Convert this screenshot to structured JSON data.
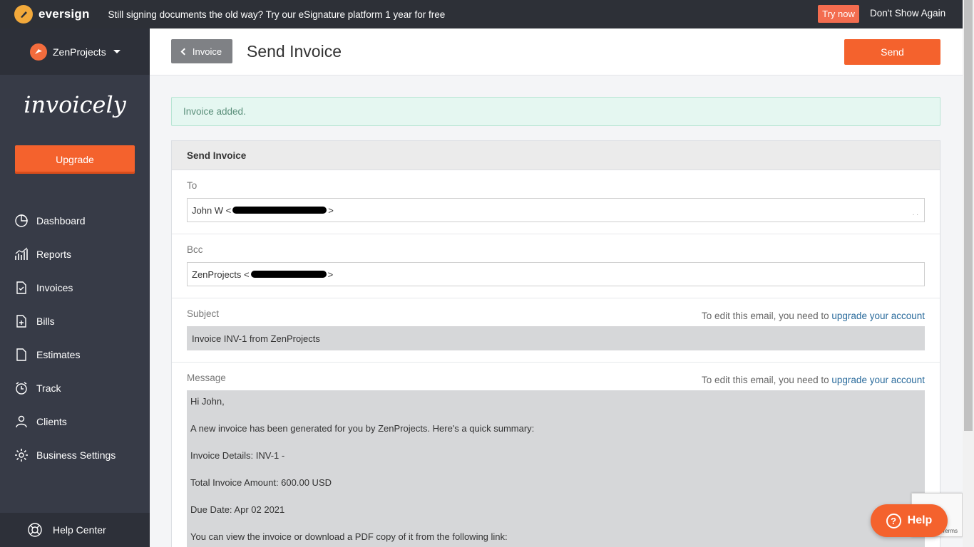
{
  "promo": {
    "brand": "eversign",
    "message": "Still signing documents the old way? Try our eSignature platform 1 year for free",
    "try_label": "Try now",
    "dismiss_label": "Don't Show Again"
  },
  "sidebar": {
    "business_name": "ZenProjects",
    "brand": "invoicely",
    "upgrade_label": "Upgrade",
    "items": [
      {
        "label": "Dashboard",
        "icon": "dashboard-icon"
      },
      {
        "label": "Reports",
        "icon": "reports-icon"
      },
      {
        "label": "Invoices",
        "icon": "invoices-icon"
      },
      {
        "label": "Bills",
        "icon": "bills-icon"
      },
      {
        "label": "Estimates",
        "icon": "estimates-icon"
      },
      {
        "label": "Track",
        "icon": "track-icon"
      },
      {
        "label": "Clients",
        "icon": "clients-icon"
      },
      {
        "label": "Business Settings",
        "icon": "gear-icon"
      }
    ],
    "help_center_label": "Help Center"
  },
  "header": {
    "back_label": "Invoice",
    "title": "Send Invoice",
    "send_label": "Send"
  },
  "alert": {
    "message": "Invoice added."
  },
  "panel": {
    "title": "Send Invoice",
    "to": {
      "label": "To",
      "value": "John W <"
    },
    "bcc": {
      "label": "Bcc",
      "value": "ZenProjects <"
    },
    "subject": {
      "label": "Subject",
      "note": "To edit this email, you need to ",
      "note_link": "upgrade your account",
      "value": "Invoice INV-1 from ZenProjects"
    },
    "message": {
      "label": "Message",
      "note": "To edit this email, you need to ",
      "note_link": "upgrade your account",
      "lines": [
        "Hi John,",
        "A new invoice has been generated for you by ZenProjects. Here's a quick summary:",
        "Invoice Details: INV-1 -",
        "Total Invoice Amount: 600.00 USD",
        "Due Date: Apr 02 2021",
        "You can view the invoice or download a PDF copy of it from the following link:"
      ]
    }
  },
  "help_widget": {
    "label": "Help"
  },
  "recaptcha": {
    "terms": "Terms"
  },
  "colors": {
    "accent": "#f4622d",
    "sidebar_bg": "#373b47",
    "promo_bg": "#2d3037",
    "alert_bg": "#e5f7f1",
    "link": "#2a6b9c"
  }
}
